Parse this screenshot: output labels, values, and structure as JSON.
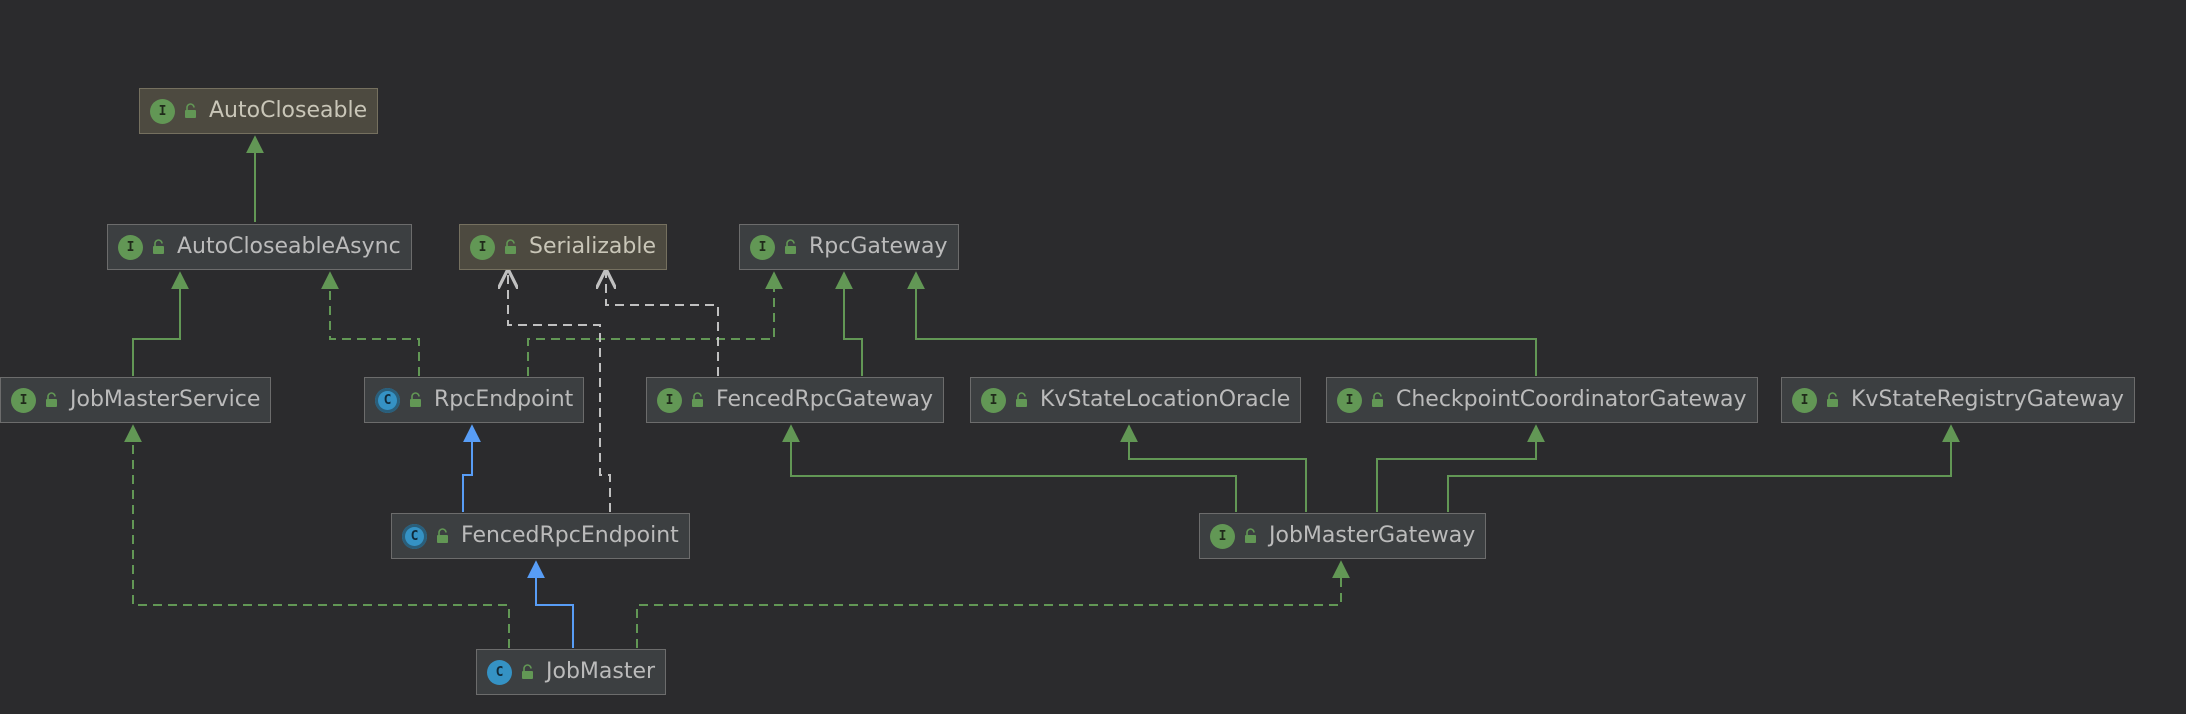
{
  "colors": {
    "background": "#2b2b2d",
    "extends_class": "#589df6",
    "implements_interface": "#629755",
    "dependency": "#c0c0c0"
  },
  "nodes": {
    "autocloseable": {
      "label": "AutoCloseable",
      "kind": "interface",
      "kind_letter": "I",
      "library": true
    },
    "autocloseableasync": {
      "label": "AutoCloseableAsync",
      "kind": "interface",
      "kind_letter": "I",
      "library": false
    },
    "serializable": {
      "label": "Serializable",
      "kind": "interface",
      "kind_letter": "I",
      "library": true
    },
    "rpcgateway": {
      "label": "RpcGateway",
      "kind": "interface",
      "kind_letter": "I",
      "library": false
    },
    "jobmasterservice": {
      "label": "JobMasterService",
      "kind": "interface",
      "kind_letter": "I",
      "library": false
    },
    "rpcendpoint": {
      "label": "RpcEndpoint",
      "kind": "abstract-class",
      "kind_letter": "C",
      "library": false
    },
    "fencedrpcgateway": {
      "label": "FencedRpcGateway",
      "kind": "interface",
      "kind_letter": "I",
      "library": false
    },
    "kvstatelocationoracle": {
      "label": "KvStateLocationOracle",
      "kind": "interface",
      "kind_letter": "I",
      "library": false
    },
    "checkpointcoordinatorgateway": {
      "label": "CheckpointCoordinatorGateway",
      "kind": "interface",
      "kind_letter": "I",
      "library": false
    },
    "kvstateregistrygateway": {
      "label": "KvStateRegistryGateway",
      "kind": "interface",
      "kind_letter": "I",
      "library": false
    },
    "fencedrpcendpoint": {
      "label": "FencedRpcEndpoint",
      "kind": "abstract-class",
      "kind_letter": "C",
      "library": false
    },
    "jobmastergateway": {
      "label": "JobMasterGateway",
      "kind": "interface",
      "kind_letter": "I",
      "library": false
    },
    "jobmaster": {
      "label": "JobMaster",
      "kind": "class",
      "kind_letter": "C",
      "library": false
    }
  },
  "edges": [
    {
      "from": "AutoCloseableAsync",
      "to": "AutoCloseable",
      "relation": "extends-interface"
    },
    {
      "from": "JobMasterService",
      "to": "AutoCloseableAsync",
      "relation": "extends-interface"
    },
    {
      "from": "RpcEndpoint",
      "to": "AutoCloseableAsync",
      "relation": "implements"
    },
    {
      "from": "RpcEndpoint",
      "to": "RpcGateway",
      "relation": "implements"
    },
    {
      "from": "FencedRpcGateway",
      "to": "RpcGateway",
      "relation": "extends-interface"
    },
    {
      "from": "FencedRpcGateway",
      "to": "Serializable",
      "relation": "dependency"
    },
    {
      "from": "FencedRpcEndpoint",
      "to": "Serializable",
      "relation": "dependency"
    },
    {
      "from": "CheckpointCoordinatorGateway",
      "to": "RpcGateway",
      "relation": "extends-interface"
    },
    {
      "from": "FencedRpcEndpoint",
      "to": "RpcEndpoint",
      "relation": "extends-class"
    },
    {
      "from": "JobMasterGateway",
      "to": "FencedRpcGateway",
      "relation": "extends-interface"
    },
    {
      "from": "JobMasterGateway",
      "to": "KvStateLocationOracle",
      "relation": "extends-interface"
    },
    {
      "from": "JobMasterGateway",
      "to": "CheckpointCoordinatorGateway",
      "relation": "extends-interface"
    },
    {
      "from": "JobMasterGateway",
      "to": "KvStateRegistryGateway",
      "relation": "extends-interface"
    },
    {
      "from": "JobMaster",
      "to": "FencedRpcEndpoint",
      "relation": "extends-class"
    },
    {
      "from": "JobMaster",
      "to": "JobMasterService",
      "relation": "implements"
    },
    {
      "from": "JobMaster",
      "to": "JobMasterGateway",
      "relation": "implements"
    }
  ]
}
